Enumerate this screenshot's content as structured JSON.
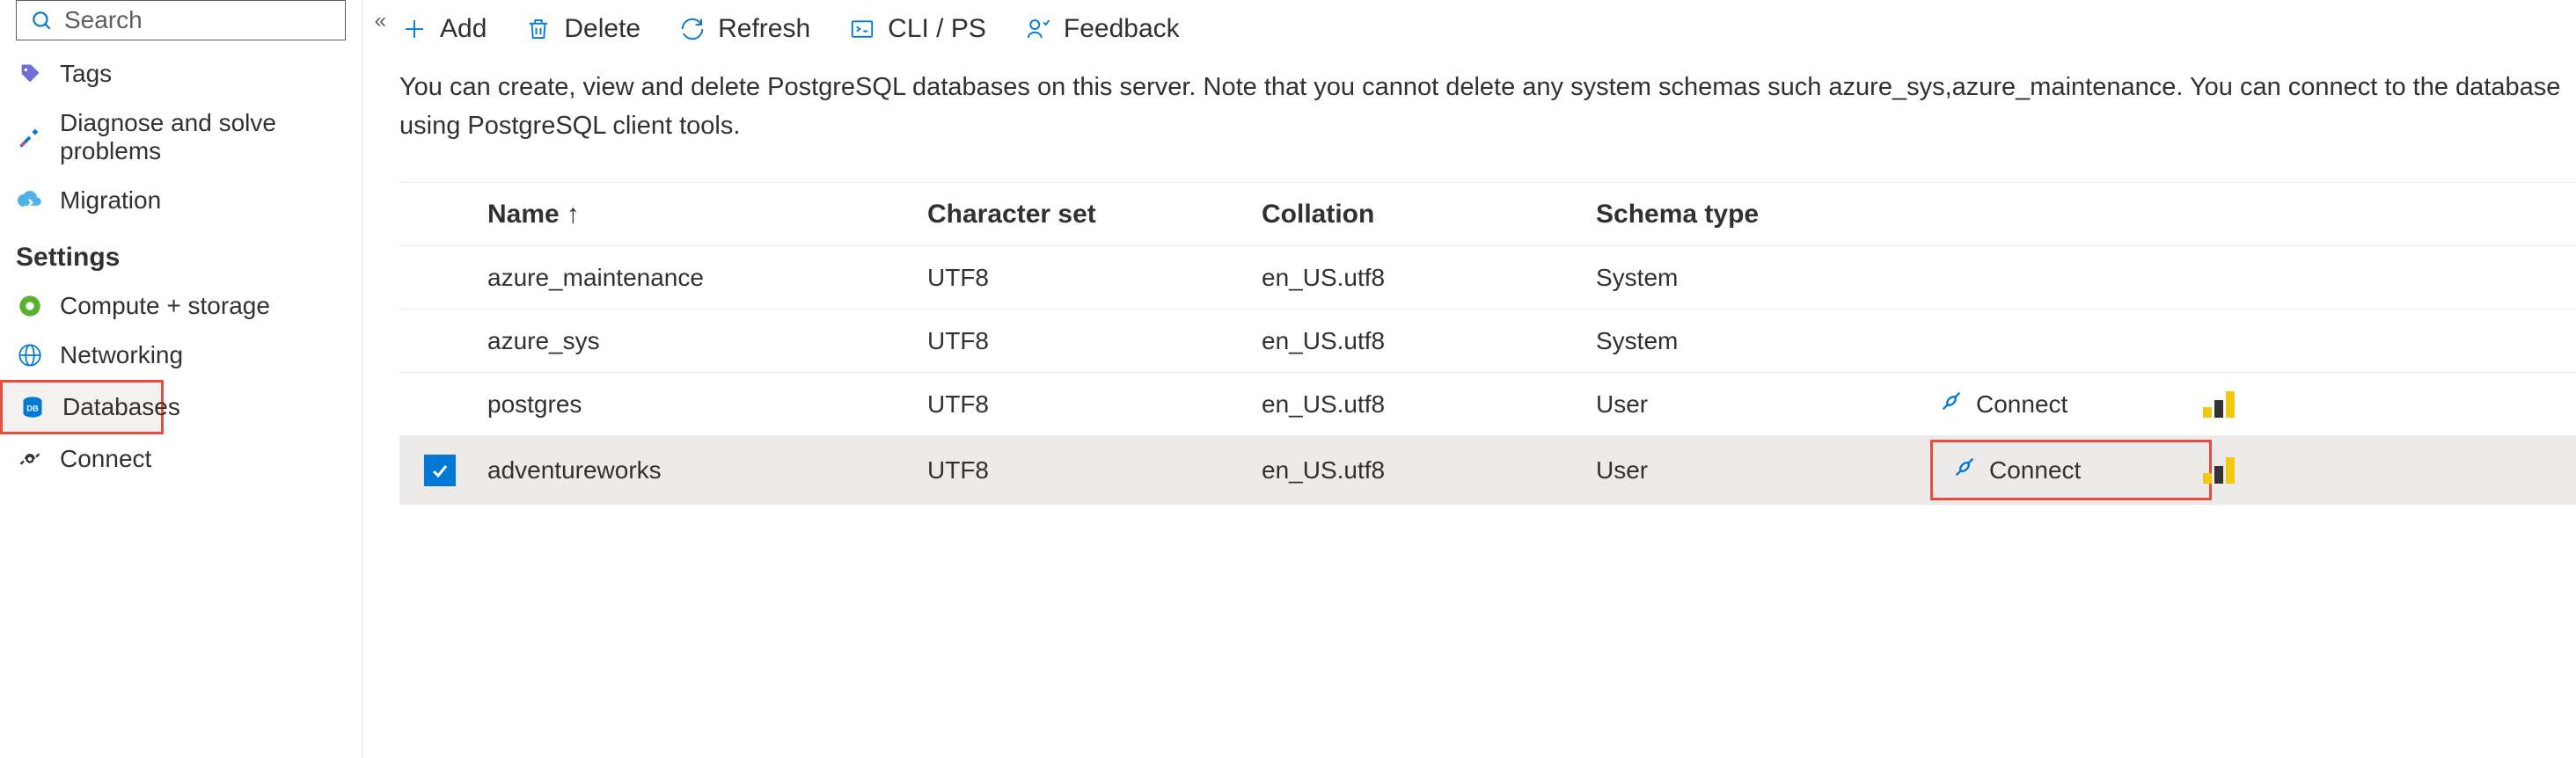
{
  "sidebar": {
    "search_placeholder": "Search",
    "items_top": [
      {
        "label": "Tags"
      },
      {
        "label": "Diagnose and solve problems"
      },
      {
        "label": "Migration"
      }
    ],
    "section_settings": "Settings",
    "items_settings": [
      {
        "label": "Compute + storage"
      },
      {
        "label": "Networking"
      },
      {
        "label": "Databases",
        "selected": true
      },
      {
        "label": "Connect"
      }
    ]
  },
  "toolbar": {
    "add": "Add",
    "delete": "Delete",
    "refresh": "Refresh",
    "cli": "CLI / PS",
    "feedback": "Feedback"
  },
  "description": "You can create, view and delete PostgreSQL databases on this server. Note that you cannot delete any system schemas such azure_sys,azure_maintenance. You can connect to the database using PostgreSQL client tools.",
  "table": {
    "columns": {
      "name": "Name",
      "charset": "Character set",
      "collation": "Collation",
      "schema": "Schema type"
    },
    "sort_indicator": "↑",
    "connect_label": "Connect",
    "rows": [
      {
        "name": "azure_maintenance",
        "charset": "UTF8",
        "collation": "en_US.utf8",
        "schema": "System",
        "show_connect": false
      },
      {
        "name": "azure_sys",
        "charset": "UTF8",
        "collation": "en_US.utf8",
        "schema": "System",
        "show_connect": false
      },
      {
        "name": "postgres",
        "charset": "UTF8",
        "collation": "en_US.utf8",
        "schema": "User",
        "show_connect": true
      },
      {
        "name": "adventureworks",
        "charset": "UTF8",
        "collation": "en_US.utf8",
        "schema": "User",
        "show_connect": true,
        "selected": true,
        "highlight_connect": true
      }
    ]
  }
}
